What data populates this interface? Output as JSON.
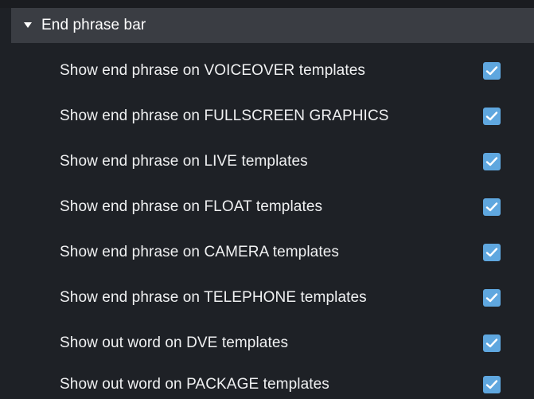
{
  "section": {
    "title": "End phrase bar",
    "expanded": true
  },
  "settings": [
    {
      "label": "Show end phrase on VOICEOVER templates",
      "checked": true
    },
    {
      "label": "Show end phrase on FULLSCREEN GRAPHICS",
      "checked": true
    },
    {
      "label": "Show end phrase on LIVE templates",
      "checked": true
    },
    {
      "label": "Show end phrase on FLOAT templates",
      "checked": true
    },
    {
      "label": "Show end phrase on CAMERA templates",
      "checked": true
    },
    {
      "label": "Show end phrase on TELEPHONE templates",
      "checked": true
    },
    {
      "label": "Show out word on DVE templates",
      "checked": true
    },
    {
      "label": "Show out word on PACKAGE templates",
      "checked": true
    }
  ],
  "colors": {
    "background": "#1e2126",
    "header": "#3a3d43",
    "checkbox": "#5fa7df"
  },
  "icons": {
    "caret": "caret-down-icon",
    "check": "checkmark-icon"
  }
}
